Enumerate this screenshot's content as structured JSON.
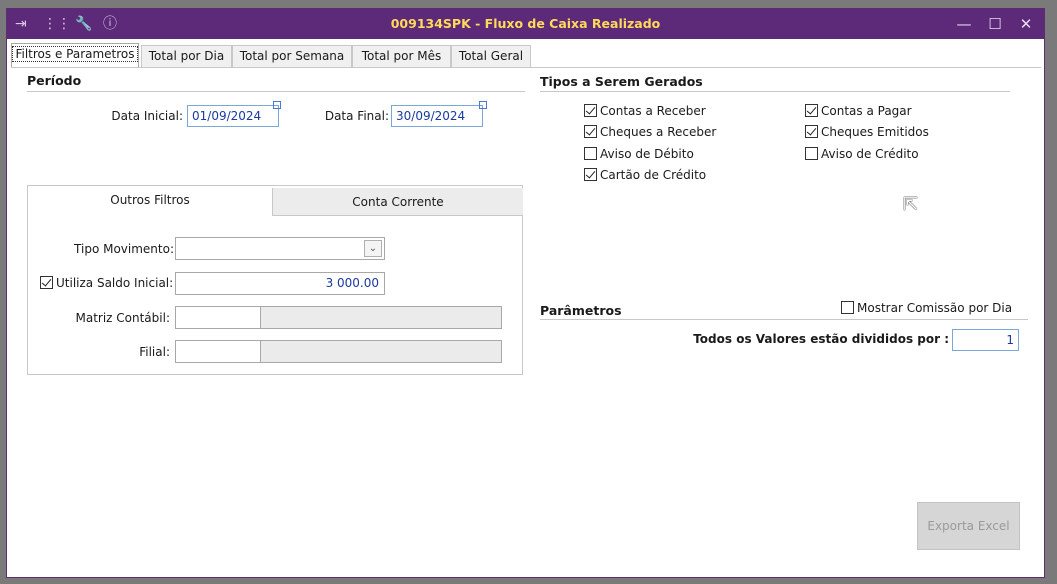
{
  "window": {
    "title": "009134SPK - Fluxo de Caixa Realizado",
    "toolbar_icons": [
      "arrow-into-list-icon",
      "traffic-light-icon",
      "wrench-icon",
      "info-icon"
    ],
    "controls": {
      "minimize": "—",
      "maximize": "☐",
      "close": "✕"
    }
  },
  "tabs": [
    "Filtros e Parametros",
    "Total por Dia",
    "Total por Semana",
    "Total por Mês",
    "Total Geral"
  ],
  "periodo": {
    "title": "Período",
    "data_inicial_label": "Data Inicial:",
    "data_inicial_value": "01/09/2024",
    "data_final_label": "Data Final:",
    "data_final_value": "30/09/2024"
  },
  "tipos": {
    "title": "Tipos a Serem Gerados",
    "items": [
      {
        "label": "Contas a Receber",
        "checked": true
      },
      {
        "label": "Contas a Pagar",
        "checked": true
      },
      {
        "label": "Cheques a Receber",
        "checked": true
      },
      {
        "label": "Cheques Emitidos",
        "checked": true
      },
      {
        "label": "Aviso de Débito",
        "checked": false
      },
      {
        "label": "Aviso de Crédito",
        "checked": false
      },
      {
        "label": "Cartão de Crédito",
        "checked": true
      }
    ]
  },
  "filtros": {
    "tabs": [
      "Outros Filtros",
      "Conta Corrente"
    ],
    "tipo_movimento_label": "Tipo Movimento:",
    "tipo_movimento_value": "",
    "utiliza_saldo_label": "Utiliza Saldo Inicial:",
    "utiliza_saldo_checked": true,
    "saldo_value": "3 000.00",
    "matriz_label": "Matriz Contábil:",
    "filial_label": "Filial:"
  },
  "parametros": {
    "title": "Parâmetros",
    "mostrar_comissao_label": "Mostrar Comissão por Dia",
    "mostrar_comissao_checked": false,
    "divididos_label": "Todos os Valores estão divididos por :",
    "divididos_value": "1"
  },
  "export_button": "Exporta Excel",
  "colors": {
    "titlebar": "#5c2a78",
    "title_text": "#ffd95a",
    "field_text": "#1a3aa0"
  }
}
